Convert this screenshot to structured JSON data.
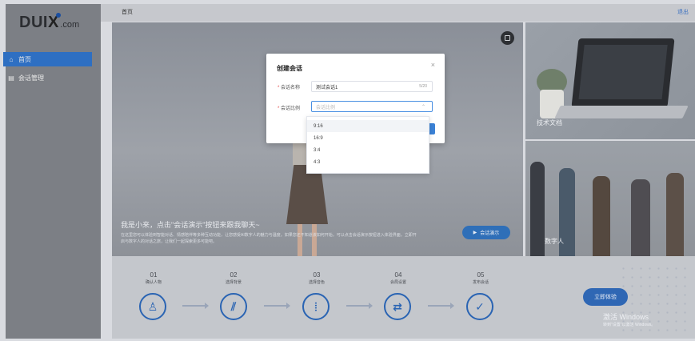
{
  "brand": {
    "logo_big": "DUI",
    "logo_x": "X",
    "logo_small": ".com"
  },
  "header": {
    "breadcrumb": "首页",
    "logout": "退出"
  },
  "sidebar": {
    "items": [
      {
        "label": "首页",
        "icon": "home-icon",
        "active": true
      },
      {
        "label": "会话管理",
        "icon": "list-icon",
        "active": false
      }
    ]
  },
  "hero": {
    "title": "我是小来，点击\"会话演示\"按钮来跟我聊天~",
    "description": "在这里您可以体验到智能对话、情感陪伴等多种互动功能，让您感受AI数字人的魅力与温度。如果您还不知道该如何开始，可以点击会话演示按钮进入体验界面，立即开启与数字人的对话之旅，让我们一起探索更多可能吧。",
    "demo_button": "会话演示"
  },
  "thumbs": [
    {
      "caption": "技术文档"
    },
    {
      "caption": "数字人"
    }
  ],
  "steps": [
    {
      "num": "01",
      "label": "确认人物",
      "icon": "person-icon",
      "glyph": "♙"
    },
    {
      "num": "02",
      "label": "选择背景",
      "icon": "pattern-icon",
      "glyph": "⫽"
    },
    {
      "num": "03",
      "label": "选择音色",
      "icon": "waveform-icon",
      "glyph": "⦙"
    },
    {
      "num": "04",
      "label": "会局设置",
      "icon": "switch-icon",
      "glyph": "⇄"
    },
    {
      "num": "05",
      "label": "发布会话",
      "icon": "check-icon",
      "glyph": "✓"
    }
  ],
  "try_button": "立即体验",
  "watermark": {
    "line1": "激活 Windows",
    "line2": "转到\"设置\"以激活 Windows。"
  },
  "modal": {
    "title": "创建会话",
    "close": "×",
    "name_label": "会话名称",
    "name_value": "测试会话1",
    "name_count": "5/20",
    "ratio_label": "会话比例",
    "ratio_placeholder": "会话比例",
    "caret": "⌃"
  },
  "dropdown": {
    "options": [
      "9:16",
      "16:9",
      "3:4",
      "4:3"
    ]
  },
  "colors": {
    "accent": "#2e6fc2",
    "modal_bg": "#ffffff",
    "overlay": "#8a8f98"
  }
}
